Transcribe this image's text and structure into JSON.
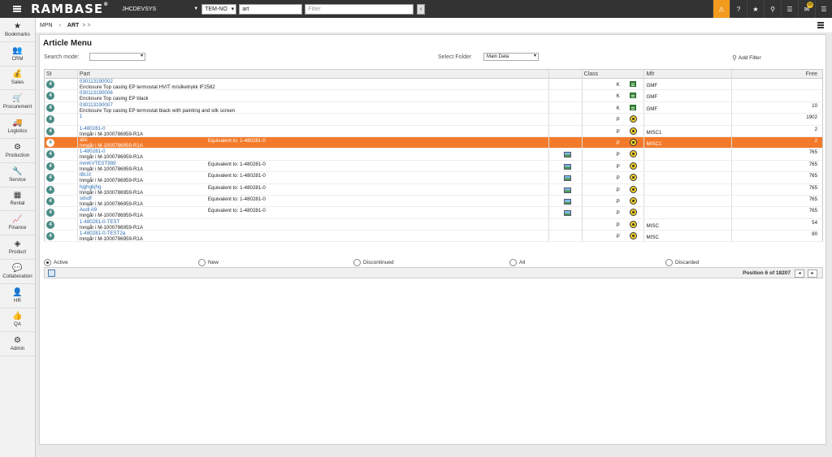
{
  "topbar": {
    "logo": "RAMBASE",
    "logo_mark": "®",
    "system": "JHCDEVSYS",
    "company": "TEM-NO",
    "search_value": "art",
    "filter_placeholder": "Filter",
    "go_label": "‹",
    "mail_count": "65"
  },
  "sidebar": {
    "items": [
      {
        "label": "Bookmarks",
        "icon": "★"
      },
      {
        "label": "CRM",
        "icon": "👥"
      },
      {
        "label": "Sales",
        "icon": "💰"
      },
      {
        "label": "Procurement",
        "icon": "🛒"
      },
      {
        "label": "Logistics",
        "icon": "🚚"
      },
      {
        "label": "Production",
        "icon": "⚙"
      },
      {
        "label": "Service",
        "icon": "🔧"
      },
      {
        "label": "Rental",
        "icon": "▦"
      },
      {
        "label": "Finance",
        "icon": "📈"
      },
      {
        "label": "Product",
        "icon": "◈"
      },
      {
        "label": "Collaboration",
        "icon": "💬"
      },
      {
        "label": "HR",
        "icon": "👤"
      },
      {
        "label": "QA",
        "icon": "👍"
      },
      {
        "label": "Admin",
        "icon": "⚙"
      }
    ]
  },
  "breadcrumb": {
    "first": "MPN",
    "sep": "›",
    "current": "ART",
    "more": "> >"
  },
  "panel": {
    "title": "Article Menu",
    "search_mode_label": "Search mode:",
    "select_folder_label": "Select Folder",
    "folder_value": "Main Data",
    "add_filter": "Add Filter"
  },
  "grid": {
    "headers": {
      "st": "St",
      "part": "Part",
      "img": "",
      "class": "Class",
      "mfr": "Mfr",
      "free": "Free"
    },
    "rows": [
      {
        "st": "4",
        "part_no": "030113190002",
        "desc": "Enclosure Top casing EP termostat HVIT m/silketrykk IF2582",
        "equiv": "",
        "img": false,
        "class": "K",
        "class_type": "k",
        "mfr": "GMF",
        "free": ""
      },
      {
        "st": "4",
        "part_no": "030113190006",
        "desc": "Enclosure Top casing EP black",
        "equiv": "",
        "img": false,
        "class": "K",
        "class_type": "k",
        "mfr": "GMF",
        "free": ""
      },
      {
        "st": "4",
        "part_no": "030113190007",
        "desc": "Enclosure Top casing EP termostat black with painting and silk screen",
        "equiv": "",
        "img": false,
        "class": "K",
        "class_type": "k",
        "mfr": "GMF",
        "free": "10"
      },
      {
        "st": "4",
        "part_no": "1",
        "desc": "",
        "equiv": "",
        "img": false,
        "class": "P",
        "class_type": "p",
        "mfr": "",
        "free": "1902"
      },
      {
        "st": "4",
        "part_no": "1-480281-0",
        "desc": "Inngår i M-1000786959-R1A",
        "equiv": "",
        "img": false,
        "class": "P",
        "class_type": "p",
        "mfr": "MISC1",
        "free": "2"
      },
      {
        "st": "4",
        "part_no": "abc",
        "desc": "Inngår i M-1000786959-R1A",
        "equiv": "Equivalent to: 1-480281-0",
        "img": false,
        "class": "P",
        "class_type": "p",
        "mfr": "MISC1",
        "free": "2",
        "selected": true
      },
      {
        "st": "4",
        "part_no": "1-480281-0",
        "desc": "Inngår i M-1000786959-R1A",
        "equiv": "",
        "img": true,
        "class": "P",
        "class_type": "p",
        "mfr": "",
        "free": "765"
      },
      {
        "st": "4",
        "part_no": "mmKVTEST999",
        "desc": "Inngår i M-1000786959-R1A",
        "equiv": "Equivalent to: 1-480281-0",
        "img": true,
        "class": "P",
        "class_type": "p",
        "mfr": "",
        "free": "765"
      },
      {
        "st": "4",
        "part_no": "IBUX",
        "desc": "Inngår i M-1000786959-R1A",
        "equiv": "Equivalent to: 1-480281-0",
        "img": true,
        "class": "P",
        "class_type": "p",
        "mfr": "",
        "free": "765"
      },
      {
        "st": "4",
        "part_no": "hjghgkjhg",
        "desc": "Inngår i M-1000786959-R1A",
        "equiv": "Equivalent to: 1-480281-0",
        "img": true,
        "class": "P",
        "class_type": "p",
        "mfr": "",
        "free": "765"
      },
      {
        "st": "4",
        "part_no": "sdsdf",
        "desc": "Inngår i M-1000786959-R1A",
        "equiv": "Equivalent to: 1-480281-0",
        "img": true,
        "class": "P",
        "class_type": "p",
        "mfr": "",
        "free": "765"
      },
      {
        "st": "4",
        "part_no": "Audi A9",
        "desc": "Inngår i M-1000786959-R1A",
        "equiv": "Equivalent to: 1-480281-0",
        "img": true,
        "class": "P",
        "class_type": "p",
        "mfr": "",
        "free": "765"
      },
      {
        "st": "4",
        "part_no": "1-480281-0-TEST",
        "desc": "Inngår i M-1000786959-R1A",
        "equiv": "",
        "img": false,
        "class": "P",
        "class_type": "p",
        "mfr": "MISC",
        "free": "54"
      },
      {
        "st": "4",
        "part_no": "1-480281-0-TEST2a",
        "desc": "Inngår i M-1000786959-R1A",
        "equiv": "",
        "img": false,
        "class": "P",
        "class_type": "p",
        "mfr": "MISC",
        "free": "80"
      }
    ],
    "position_text": "Position 6 of 18207",
    "prev": "◂",
    "next": "▸"
  },
  "radios": [
    {
      "label": "Active",
      "checked": true
    },
    {
      "label": "New",
      "checked": false
    },
    {
      "label": "Discontinued",
      "checked": false
    },
    {
      "label": "All",
      "checked": false
    },
    {
      "label": "Discarded",
      "checked": false
    }
  ]
}
